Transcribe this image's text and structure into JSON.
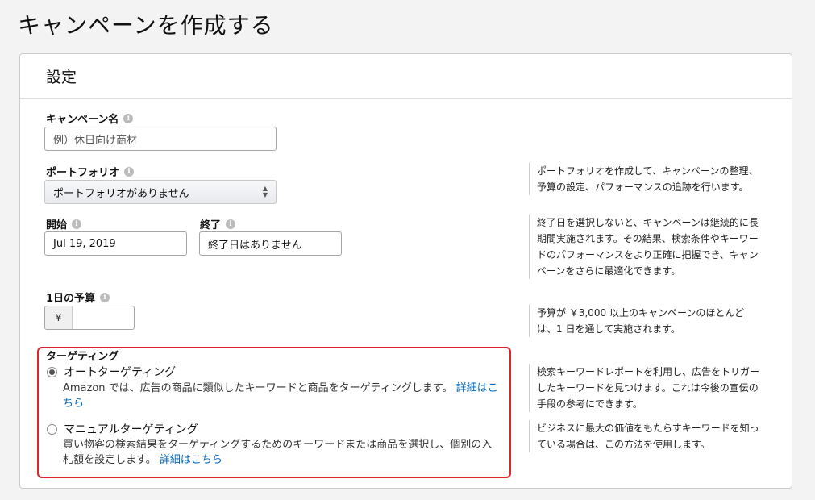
{
  "page": {
    "title": "キャンペーンを作成する"
  },
  "settings": {
    "header": "設定",
    "campaign_name": {
      "label": "キャンペーン名",
      "placeholder": "例）休日向け商材"
    },
    "portfolio": {
      "label": "ポートフォリオ",
      "selected": "ポートフォリオがありません",
      "help": "ポートフォリオを作成して、キャンペーンの整理、予算の設定、パフォーマンスの追跡を行います。"
    },
    "start": {
      "label": "開始",
      "value": "Jul 19, 2019"
    },
    "end": {
      "label": "終了",
      "value": "終了日はありません",
      "help": "終了日を選択しないと、キャンペーンは継続的に長期間実施されます。その結果、検索条件やキーワードのパフォーマンスをより正確に把握でき、キャンペーンをさらに最適化できます。"
    },
    "daily_budget": {
      "label": "1日の予算",
      "currency": "¥",
      "value": "",
      "help": "予算が ￥3,000 以上のキャンペーンのほとんどは、1 日を通して実施されます。"
    },
    "targeting": {
      "label": "ターゲティング",
      "auto": {
        "label": "オートターゲティング",
        "selected": true,
        "description": "Amazon では、広告の商品に類似したキーワードと商品をターゲティングします。",
        "link": "詳細はこちら",
        "help": "検索キーワードレポートを利用し、広告をトリガーしたキーワードを見つけます。これは今後の宣伝の手段の参考にできます。"
      },
      "manual": {
        "label": "マニュアルターゲティング",
        "selected": false,
        "description": "買い物客の検索結果をターゲティングするためのキーワードまたは商品を選択し、個別の入札額を設定します。",
        "link": "詳細はこちら",
        "help": "ビジネスに最大の価値をもたらすキーワードを知っている場合は、この方法を使用します。"
      }
    }
  },
  "icons": {
    "info": "info-icon",
    "radio": "radio-button",
    "caret": "select-caret-icon"
  },
  "colors": {
    "link": "#0066c0",
    "highlight": "#e0232c"
  }
}
